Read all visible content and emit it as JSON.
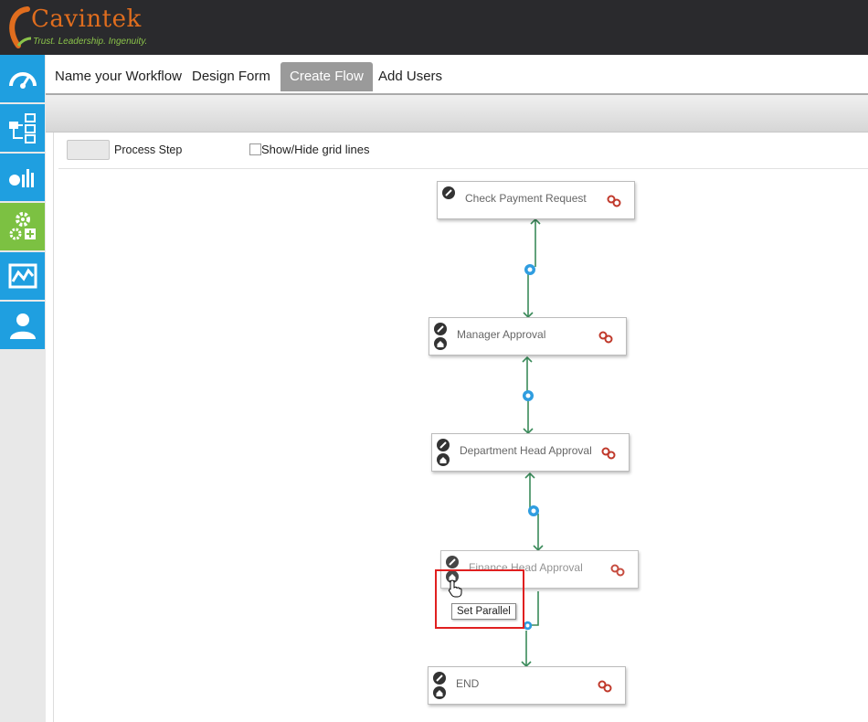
{
  "header": {
    "brand": "Cavintek",
    "tagline": "Trust. Leadership. Ingenuity."
  },
  "sidebar": {
    "items": [
      {
        "icon": "dashboard-gauge-icon",
        "active": false
      },
      {
        "icon": "workflow-icon",
        "active": false
      },
      {
        "icon": "reports-chart-icon",
        "active": false
      },
      {
        "icon": "settings-gears-icon",
        "active": true
      },
      {
        "icon": "analytics-line-icon",
        "active": false
      },
      {
        "icon": "user-icon",
        "active": false
      }
    ]
  },
  "tabs": [
    {
      "label": "Name your Workflow",
      "active": false
    },
    {
      "label": "Design Form",
      "active": false
    },
    {
      "label": "Create Flow",
      "active": true
    },
    {
      "label": "Add Users",
      "active": false
    }
  ],
  "toolbar": {
    "process_step_label": "Process Step",
    "grid_toggle_label": "Show/Hide grid lines",
    "grid_checked": false
  },
  "flow": {
    "nodes": [
      {
        "label": "Check Payment Request",
        "has_home": false
      },
      {
        "label": "Manager Approval",
        "has_home": true
      },
      {
        "label": "Department Head Approval",
        "has_home": true
      },
      {
        "label": "Finance Head Approval",
        "has_home": true
      },
      {
        "label": "END",
        "has_home": true
      }
    ],
    "tooltip": "Set Parallel"
  },
  "colors": {
    "header_bg": "#2a2a2d",
    "sidebar_blue": "#1f9fe0",
    "sidebar_active": "#7cc142",
    "connector": "#3a8a5a",
    "link_icon": "#c0392b",
    "highlight": "#e02020"
  }
}
